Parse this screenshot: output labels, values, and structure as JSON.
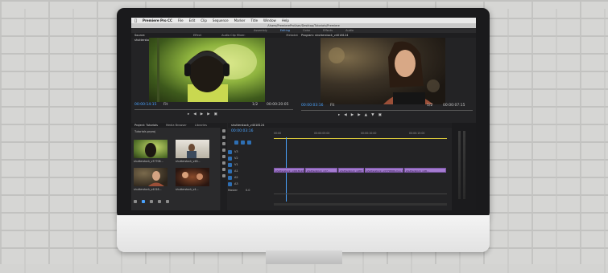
{
  "app": {
    "menu": [
      "Premiere Pro CC",
      "File",
      "Edit",
      "Clip",
      "Sequence",
      "Marker",
      "Title",
      "Window",
      "Help"
    ],
    "window_title": "/Users/PremiereProUser/Desktop/Tutorials/Premiere",
    "workspaces": [
      "Assembly",
      "Editing",
      "Color",
      "Effects",
      "Audio"
    ],
    "active_workspace": "Editing"
  },
  "source_monitor": {
    "tabs": [
      "Source: shutterstock_v3770806.mov",
      "Effect Controls",
      "Audio Clip Mixer: shutterstock_v4018124",
      "Metadata"
    ],
    "timecode_in": "00:00:14:15",
    "fit": "Fit",
    "page": "1/2",
    "timecode_out": "00:00:20:05"
  },
  "program_monitor": {
    "tabs": [
      "Program: shutterstock_v4018124"
    ],
    "timecode_in": "00:00:03:16",
    "fit": "Fit",
    "page": "1/2",
    "timecode_out": "00:00:07:15"
  },
  "project_panel": {
    "tabs": [
      "Project: Tutorials",
      "Media Browser",
      "Libraries"
    ],
    "bin": "Tutorials.prproj",
    "items": [
      {
        "label": "shutterstock_v37708..."
      },
      {
        "label": "shutterstock_v48..."
      },
      {
        "label": "shutterstock_v4018..."
      },
      {
        "label": "shutterstock_v4..."
      }
    ]
  },
  "timeline": {
    "tab": "shutterstock_v4018124",
    "timecode": "00:00:03:16",
    "ruler": [
      "00:00",
      "00:00:05:00",
      "00:00:10:00",
      "00:00:15:00"
    ],
    "tracks": [
      "V3",
      "V2",
      "V1",
      "A1",
      "A2",
      "A3"
    ],
    "master": "Master",
    "master_value": "0.0",
    "clips": [
      "shutterstock_v4018124.mov [V]",
      "shutterstock_v37...",
      "shutterstock_v487...",
      "shutterstock_v3770806.mov [V]",
      "shutterstock_v48..."
    ]
  },
  "colors": {
    "accent": "#4aa3ff",
    "clip": "#a57bd1",
    "panel": "#232325"
  }
}
